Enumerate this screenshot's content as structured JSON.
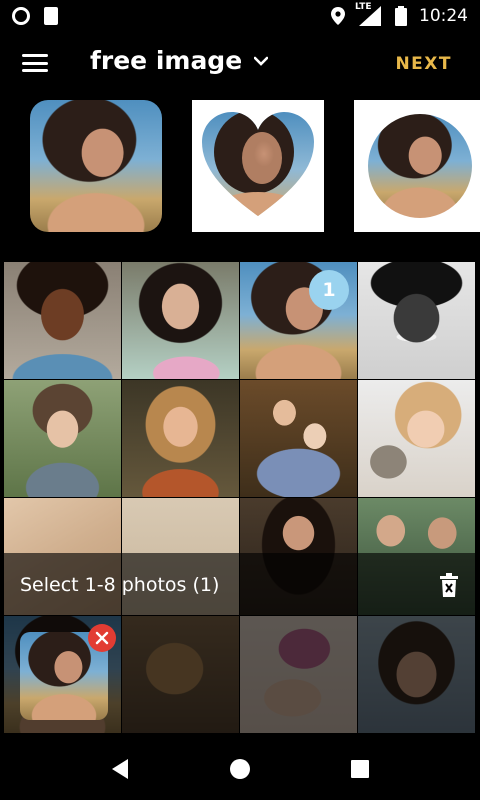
{
  "status_bar": {
    "time": "10:24",
    "network": "LTE",
    "icons": [
      "record-icon",
      "sd-card-icon",
      "location-icon",
      "signal-icon",
      "battery-icon"
    ]
  },
  "app_bar": {
    "title": "free image",
    "next_label": "NEXT",
    "accent_color": "#e8b84a",
    "icons": [
      "menu-icon",
      "chevron-down-icon"
    ]
  },
  "shape_options": [
    {
      "shape": "rounded-square"
    },
    {
      "shape": "heart"
    },
    {
      "shape": "circle"
    }
  ],
  "gallery": {
    "selected_badge": "1",
    "badge_color": "#9ad3ef"
  },
  "selection": {
    "text": "Select 1-8 photos (1)",
    "remove_color": "#e23c33",
    "icons": [
      "trash-icon",
      "remove-icon"
    ]
  },
  "nav_bar": {
    "icons": [
      "back-icon",
      "home-icon",
      "recents-icon"
    ]
  }
}
